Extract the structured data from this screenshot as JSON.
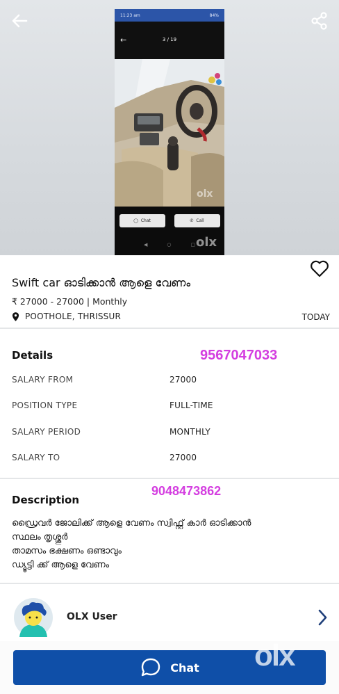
{
  "gallery": {
    "back_icon": "arrow-left-icon",
    "share_icon": "share-icon",
    "photo": {
      "status_time": "11:23 am",
      "status_battery": "84%",
      "counter": "3 / 19",
      "chat_label": "Chat",
      "call_label": "Call",
      "watermark": "olx"
    }
  },
  "listing": {
    "favorite_icon": "heart-outline-icon",
    "title": "Swift car ഓടിക്കാൻ ആളെ വേണം",
    "price": "₹ 27000 - 27000 | Monthly",
    "location": "POOTHOLE, THRISSUR",
    "posted": "TODAY"
  },
  "details": {
    "heading": "Details",
    "phone_overlay": "9567047033",
    "rows": [
      {
        "label": "SALARY FROM",
        "value": "27000"
      },
      {
        "label": "POSITION TYPE",
        "value": "FULL-TIME"
      },
      {
        "label": "SALARY PERIOD",
        "value": "MONTHLY"
      },
      {
        "label": "SALARY TO",
        "value": "27000"
      }
    ]
  },
  "description": {
    "heading": "Description",
    "phone_overlay": "9048473862",
    "lines": [
      "ഡ്രൈവർ ജോലിക്ക് ആളെ വേണം സ്വിഫ്റ്റ് കാർ ഓടിക്കാൻ",
      "സ്ഥലം തൃശ്ശൂർ",
      "താമസം ഭക്ഷണം ഒണ്ടാവും",
      "ഡ്യൂട്ടി ക്ക് ആളെ വേണം"
    ]
  },
  "seller": {
    "name": "OLX User",
    "avatar_icon": "user-avatar-icon",
    "chevron_icon": "chevron-right-icon"
  },
  "action": {
    "chat_label": "Chat",
    "chat_icon": "speech-bubble-icon",
    "watermark": "olx",
    "color": "#0f4fa8"
  },
  "colors": {
    "overlay_text": "#d43ee0",
    "accent": "#0f4fa8"
  }
}
